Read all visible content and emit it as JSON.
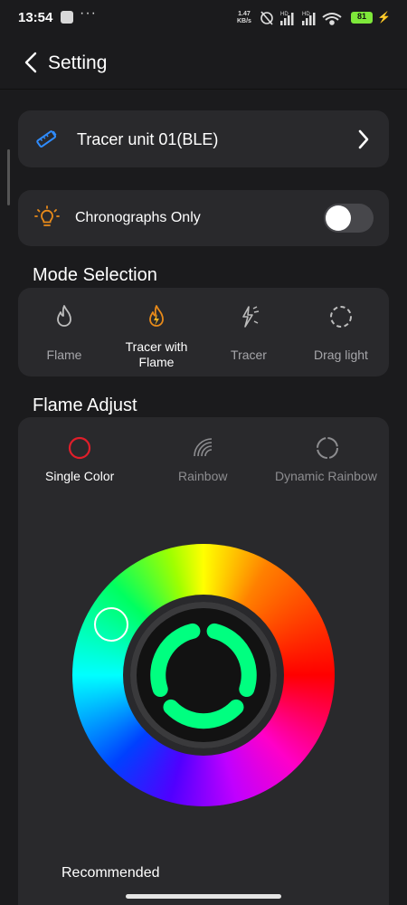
{
  "status": {
    "time": "13:54",
    "speed_value": "1.47",
    "speed_unit": "KB/s",
    "battery": "81",
    "signal_label": "HD"
  },
  "header": {
    "title": "Setting"
  },
  "device": {
    "name": "Tracer unit 01(BLE)"
  },
  "chronograph": {
    "label": "Chronographs Only",
    "enabled": false
  },
  "mode_selection": {
    "title": "Mode Selection",
    "items": [
      {
        "label": "Flame",
        "icon": "flame-icon"
      },
      {
        "label": "Tracer with Flame",
        "icon": "tracer-flame-icon",
        "selected": true
      },
      {
        "label": "Tracer",
        "icon": "tracer-icon"
      },
      {
        "label": "Drag light",
        "icon": "drag-light-icon"
      }
    ]
  },
  "flame_adjust": {
    "title": "Flame Adjust",
    "options": [
      {
        "label": "Single Color",
        "icon": "single-color-icon",
        "selected": true
      },
      {
        "label": "Rainbow",
        "icon": "rainbow-icon"
      },
      {
        "label": "Dynamic Rainbow",
        "icon": "dynamic-rainbow-icon"
      }
    ],
    "selected_color": "#00ff80",
    "picker_color": "#00ffcc"
  },
  "recommended": {
    "label": "Recommended"
  },
  "colors": {
    "accent_red": "#e01e2a",
    "flame_orange": "#e88a1a",
    "bg": "#1b1b1d",
    "card": "#29292c"
  }
}
